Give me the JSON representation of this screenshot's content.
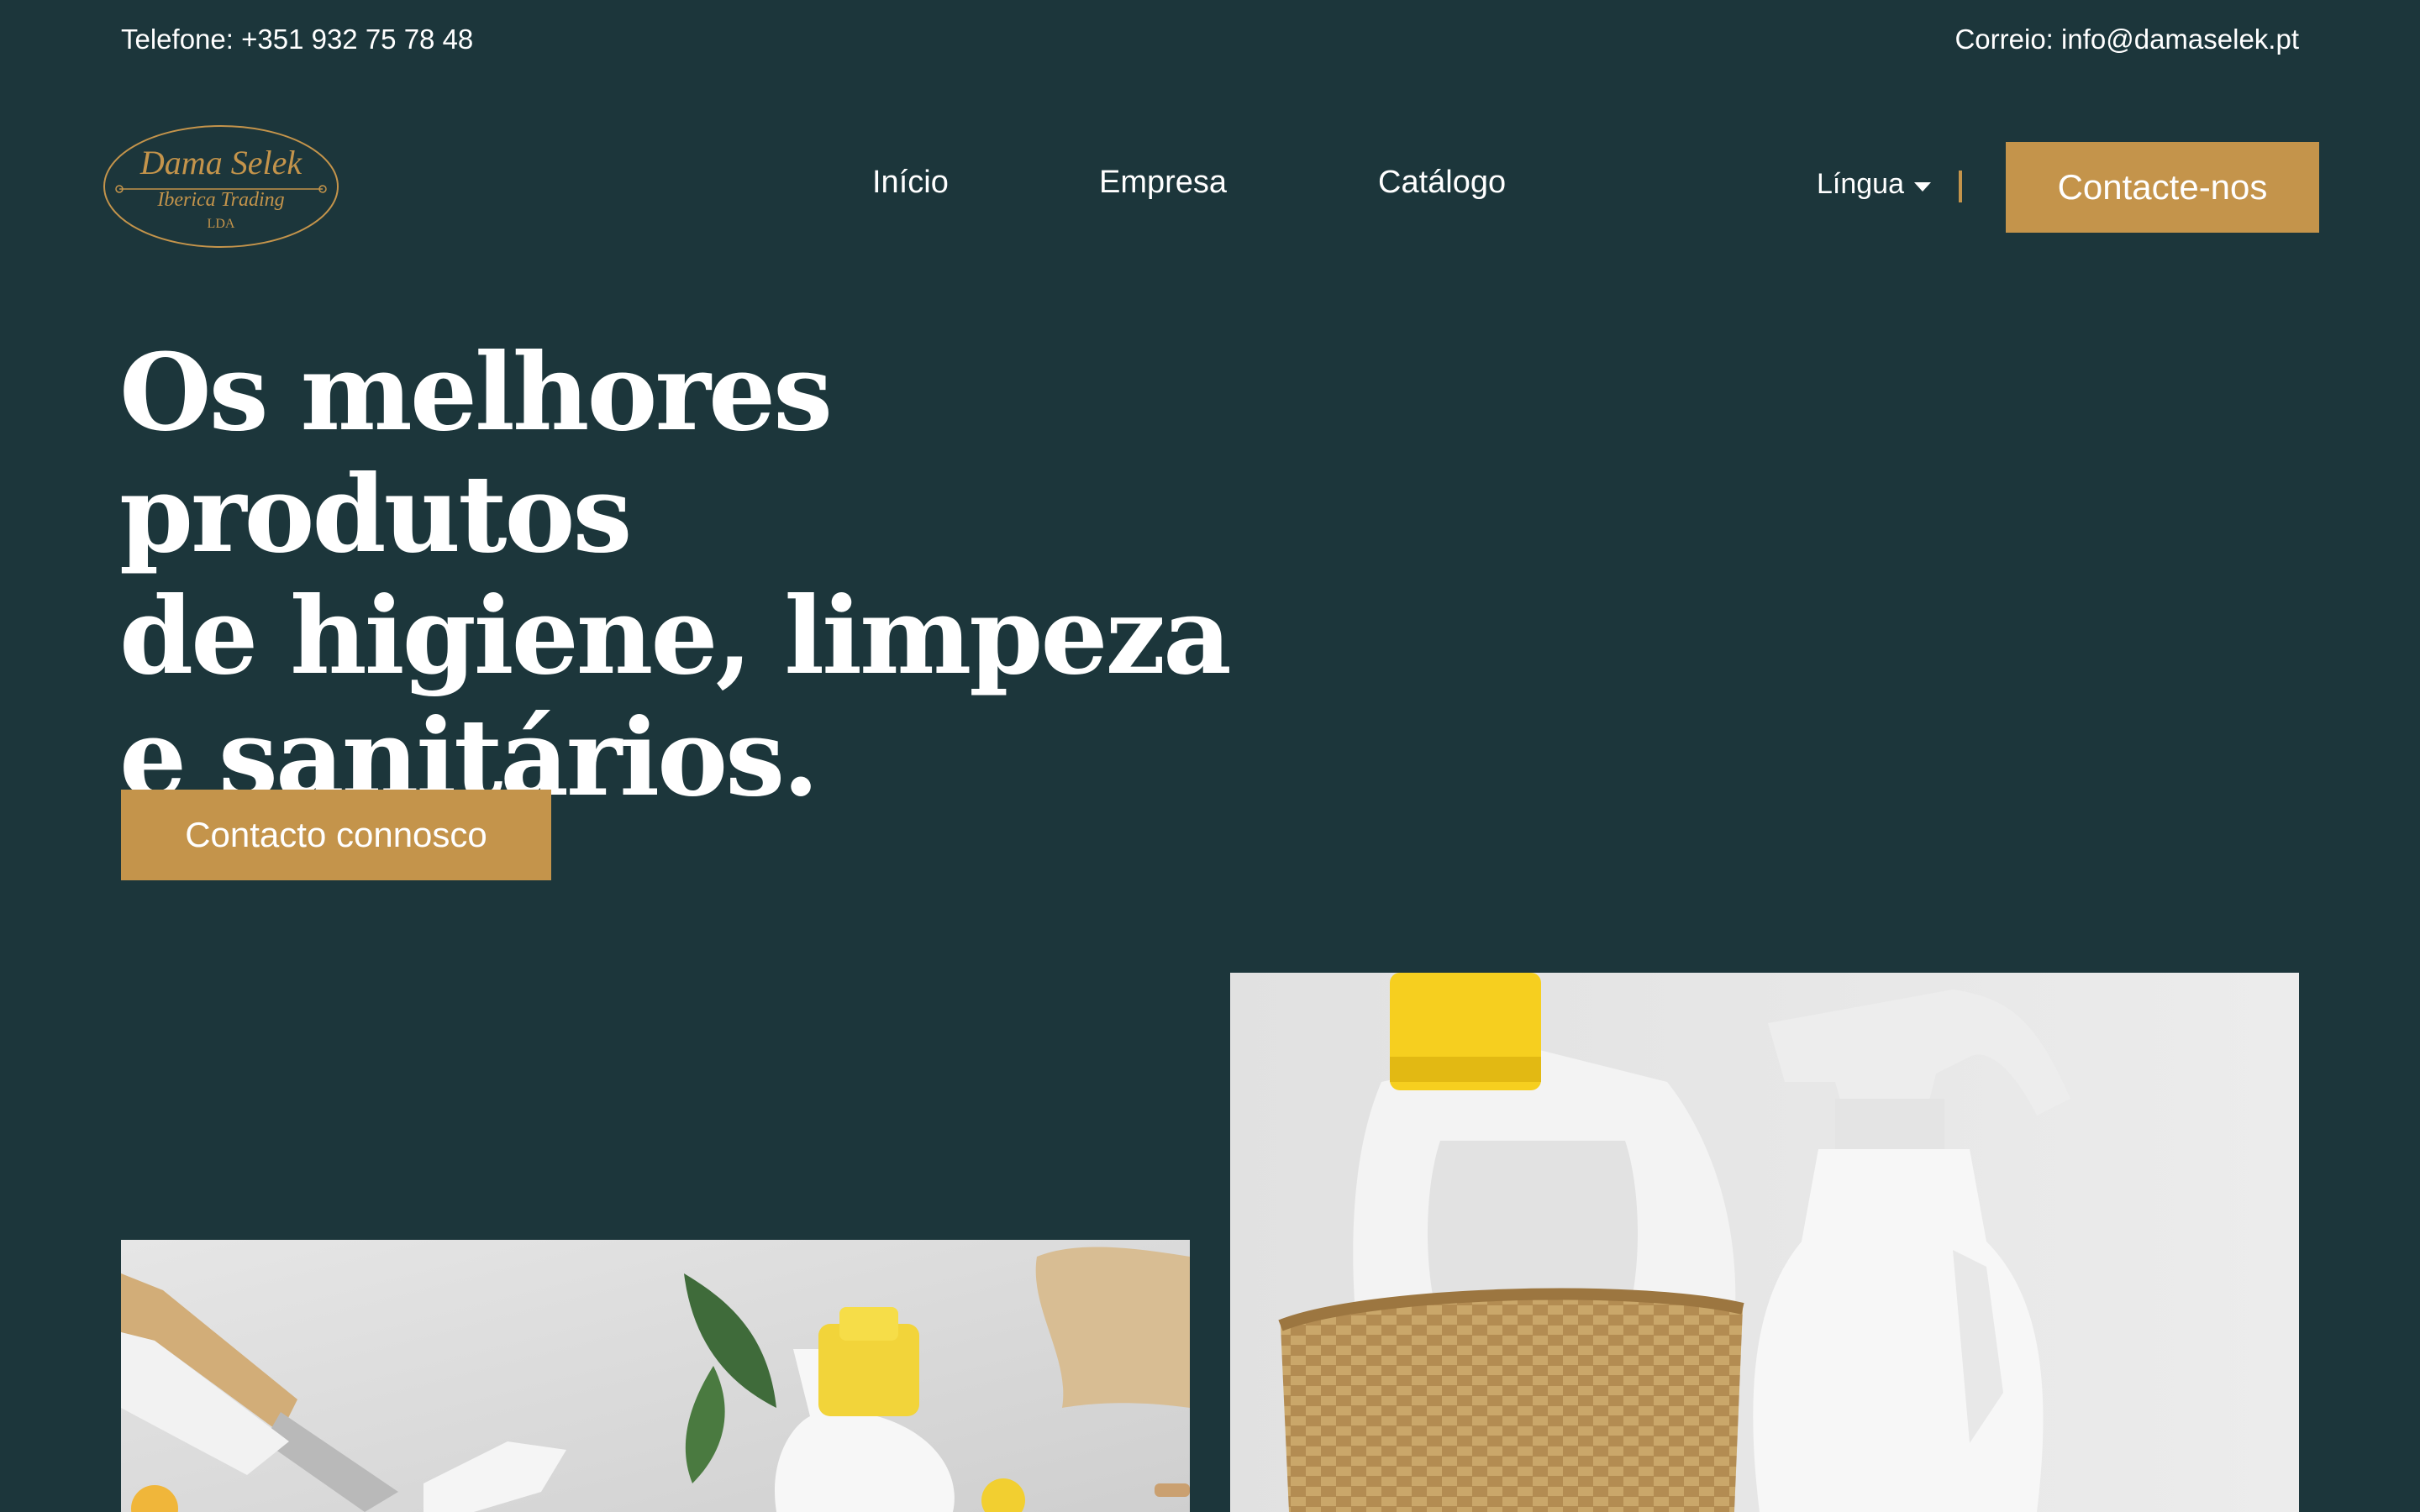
{
  "topbar": {
    "phone": "Telefone: +351 932 75 78 48",
    "email": "Correio: info@damaselek.pt"
  },
  "logo": {
    "line1": "Dama Selek",
    "line2": "Iberica Trading",
    "line3": "LDA"
  },
  "nav": {
    "items": [
      {
        "label": "Início"
      },
      {
        "label": "Empresa"
      },
      {
        "label": "Catálogo"
      }
    ]
  },
  "language": {
    "label": "Língua"
  },
  "header_cta": {
    "label": "Contacte-nos"
  },
  "hero": {
    "title_lines": [
      "Os melhores produtos",
      "de higiene, limpeza",
      "e sanitários."
    ],
    "cta_label": "Contacto connosco"
  },
  "colors": {
    "background": "#1c363b",
    "accent": "#c4944b",
    "text": "#ffffff"
  }
}
